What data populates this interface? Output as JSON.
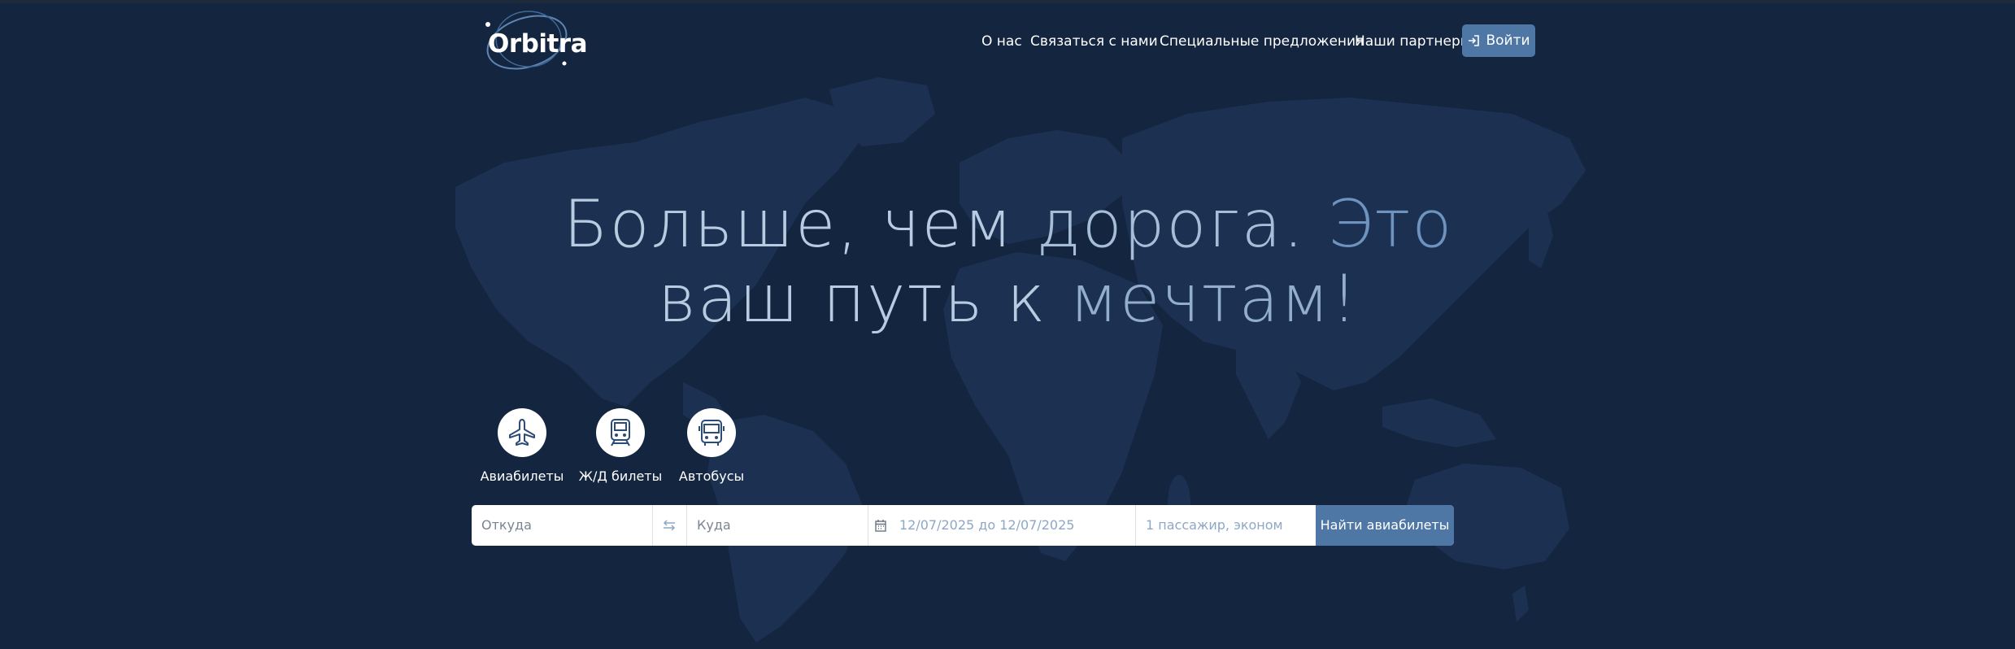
{
  "brand": {
    "logo_text": "Orbitra"
  },
  "nav": {
    "items": [
      {
        "label": "О нас"
      },
      {
        "label": "Связаться с нами"
      },
      {
        "label": "Специальные предложения"
      },
      {
        "label": "Наши партнеры"
      }
    ],
    "login_label": "Войти"
  },
  "hero": {
    "line1": {
      "part1": "Больше, чем ",
      "part2": "дорога. ",
      "part3": "Это"
    },
    "line2": {
      "part1": "ваш путь к ",
      "part2": "мечтам!"
    }
  },
  "transport_modes": [
    {
      "label": "Авиабилеты",
      "icon": "airplane-icon"
    },
    {
      "label": "Ж/Д билеты",
      "icon": "train-icon"
    },
    {
      "label": "Автобусы",
      "icon": "bus-icon"
    }
  ],
  "search": {
    "from_placeholder": "Откуда",
    "to_placeholder": "Куда",
    "dates_placeholder": "12/07/2025 до 12/07/2025",
    "passengers_placeholder": "1 пассажир, эконом",
    "submit_label": "Найти авиабилеты"
  },
  "colors": {
    "background": "#14253f",
    "accent": "#4e77a6",
    "headline_light": "#b7cbe1",
    "headline_dark": "#6e93bf"
  }
}
